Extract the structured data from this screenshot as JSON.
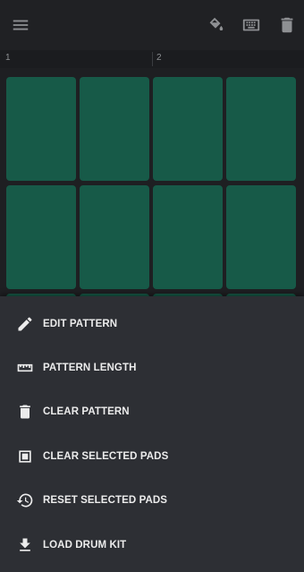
{
  "toolbar": {
    "menu_icon": "hamburger-menu-icon",
    "actions": [
      {
        "name": "bucket-icon"
      },
      {
        "name": "keyboard-icon"
      },
      {
        "name": "trash-icon"
      }
    ]
  },
  "ruler": {
    "markers": [
      "1",
      "2"
    ]
  },
  "pads": {
    "rows_visible": 2,
    "columns": 4,
    "color": "#175a48"
  },
  "sheet": {
    "background": "#2d2f34",
    "items": [
      {
        "label": "EDIT PATTERN",
        "icon": "pencil-icon"
      },
      {
        "label": "PATTERN LENGTH",
        "icon": "ruler-icon"
      },
      {
        "label": "CLEAR PATTERN",
        "icon": "trash-icon"
      },
      {
        "label": "CLEAR SELECTED PADS",
        "icon": "square-clear-icon"
      },
      {
        "label": "RESET SELECTED PADS",
        "icon": "history-reset-icon"
      },
      {
        "label": "LOAD DRUM KIT",
        "icon": "download-icon"
      }
    ]
  }
}
